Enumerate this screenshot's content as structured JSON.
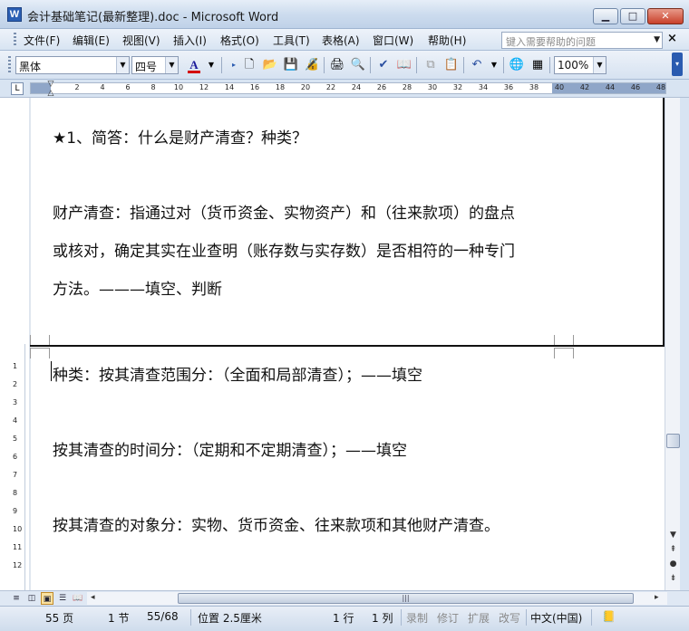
{
  "window": {
    "title": "会计基础笔记(最新整理).doc - Microsoft Word",
    "app_icon": "W",
    "minimize_icon": "minimize-icon",
    "maximize_icon": "maximize-icon",
    "close_icon": "close-icon"
  },
  "menu": {
    "items": [
      "文件(F)",
      "编辑(E)",
      "视图(V)",
      "插入(I)",
      "格式(O)",
      "工具(T)",
      "表格(A)",
      "窗口(W)",
      "帮助(H)"
    ],
    "help_placeholder": "键入需要帮助的问题",
    "close_glyph": "×"
  },
  "toolbar": {
    "font_name": "黑体",
    "font_size": "四号",
    "zoom": "100%",
    "font_color_glyph": "A",
    "font_color": "#d40000"
  },
  "ruler": {
    "numbers": [
      "2",
      "4",
      "6",
      "8",
      "10",
      "12",
      "14",
      "16",
      "18",
      "20",
      "22",
      "24",
      "26",
      "28",
      "30",
      "32",
      "34",
      "36",
      "38",
      "40",
      "42",
      "44",
      "46",
      "48"
    ],
    "vertical_numbers": [
      "1",
      "2",
      "3",
      "4",
      "5",
      "6",
      "7",
      "8",
      "9",
      "10",
      "11",
      "12"
    ]
  },
  "document": {
    "heading": "★1、简答：什么是财产清查？种类？",
    "p1_line1": "财产清查：指通过对（货币资金、实物资产）和（往来款项）的盘点",
    "p1_line2": "或核对，确定其实在业查明（账存数与实存数）是否相符的一种专门",
    "p1_line3": "方法。———填空、判断",
    "p2": "种类：按其清查范围分：（全面和局部清查）；——填空",
    "p3": "按其清查的时间分：（定期和不定期清查）；——填空",
    "p4": "按其清查的对象分：实物、货币资金、往来款项和其他财产清查。"
  },
  "statusbar": {
    "page": "55 页",
    "section": "1 节",
    "page_of": "55/68",
    "position": "位置 2.5厘米",
    "line": "1 行",
    "column": "1 列",
    "rec": "录制",
    "trk": "修订",
    "ext": "扩展",
    "ovr": "改写",
    "language": "中文(中国)"
  }
}
